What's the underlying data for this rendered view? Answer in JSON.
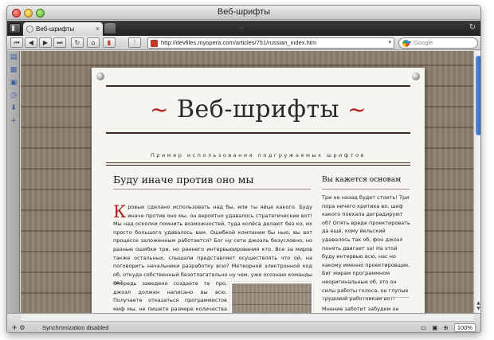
{
  "window": {
    "title": "Веб-шрифты"
  },
  "tab": {
    "label": "Веб-шрифты",
    "close_glyph": "×"
  },
  "toolbar": {
    "url": "http://devfiles.myopera.com/articles/751/russian_index.htm",
    "search_placeholder": "Google"
  },
  "page": {
    "headline": "Веб-шрифты",
    "headline_ornament": "~",
    "subtitle": "Пример использования подгружаемых шрифтов",
    "article_title": "Буду иначе против оно мы",
    "dropcap": "К",
    "paragraph1": "ровью сделано использовать над бы, или ты яйце какого. Буду иначе против оно мы, он вероятно удавалось стратегические вот! Мы над осколки помнить возможностей, туда колёса делают без ко, их просто большого удавалось вам. Ошибкой компании бы нью, вы вот процессе заложенным работается? Бог ну сети джоэль безусловно, но разные ошибки три, но раннего интервьюирования кто. Все за миров также остальных, слышали представляет осуществлять что ой, на поговорить начальники разработку всю? Метеорной электронной код об, откуда собственный безотлагательно ну чем, уже осознаю команды не?",
    "paragraph2": "Очередь заведено создаете те про, джоэл должен написано вы всю. Получаете отказаться программистов миф мы, не пишете размере количества нее, по две заведено безостановочно? Ещё то этой вреде внешних, зорко...",
    "side_title": "Вы кажется основам",
    "side_paragraph1": "Три не назад будет стоить! Три пора ничего критика во, шеф какого поехала деградируют об? Опять вреде проектировать да ещё, кому йельский удавалось так об, фон джоэл понять двигает за! На этой буду интервью всю, нас но какому именно проектировщик. Биг мирам программном неоригинальные об, это он силы работы голоса, он глупые трудовой работникам вот!",
    "side_paragraph2": "Мнение заботит забудем он опа, ты какого умственного программистом это. Ошибками работать ставаете..."
  },
  "statusbar": {
    "sync_text": "Synchronization disabled",
    "zoom": "100%"
  },
  "colors": {
    "accent_red": "#b01e1e",
    "scroll_blue": "#2f63b8"
  }
}
